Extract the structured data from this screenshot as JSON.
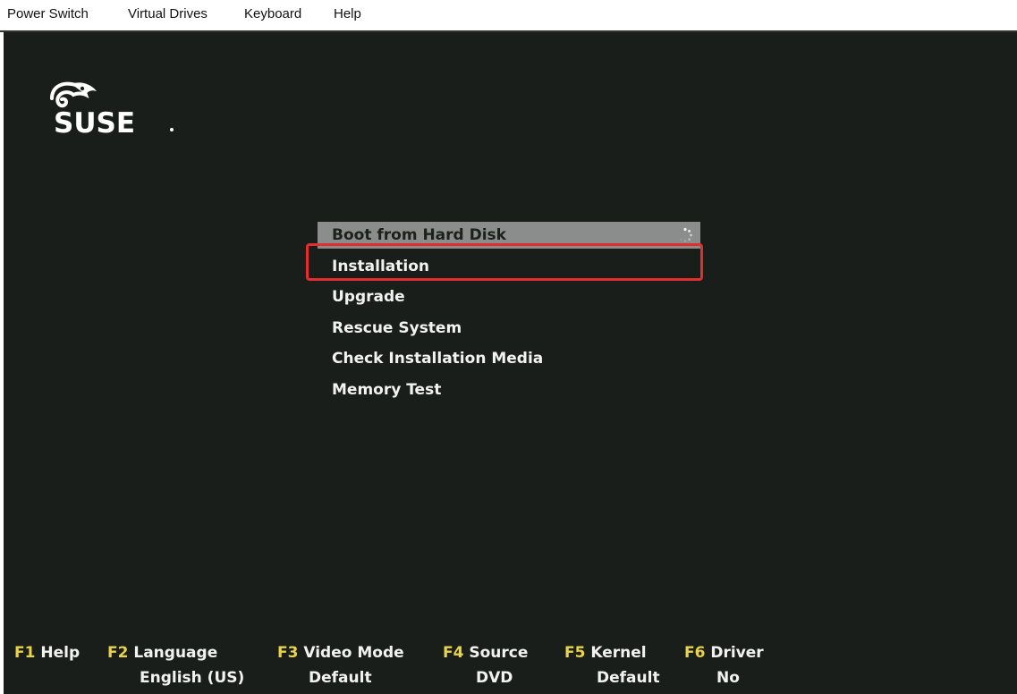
{
  "menubar": {
    "items": [
      "Power Switch",
      "Virtual Drives",
      "Keyboard",
      "Help"
    ]
  },
  "logo": {
    "text": "SUSE",
    "icon": "chameleon-icon"
  },
  "boot_menu": {
    "items": [
      {
        "label": "Boot from Hard Disk",
        "selected": true
      },
      {
        "label": "Installation",
        "selected": false
      },
      {
        "label": "Upgrade",
        "selected": false
      },
      {
        "label": "Rescue System",
        "selected": false
      },
      {
        "label": "Check Installation Media",
        "selected": false
      },
      {
        "label": "Memory Test",
        "selected": false
      }
    ],
    "spinner_icon": "loading-spinner-icon"
  },
  "annotation": {
    "highlight_color": "#e22e2e",
    "highlighted_item": "Installation"
  },
  "function_keys": [
    {
      "key": "F1",
      "label": "Help",
      "value": ""
    },
    {
      "key": "F2",
      "label": "Language",
      "value": "English (US)"
    },
    {
      "key": "F3",
      "label": "Video Mode",
      "value": "Default"
    },
    {
      "key": "F4",
      "label": "Source",
      "value": "DVD"
    },
    {
      "key": "F5",
      "label": "Kernel",
      "value": "Default"
    },
    {
      "key": "F6",
      "label": "Driver",
      "value": "No"
    }
  ],
  "colors": {
    "console_bg": "#1a1e1b",
    "selected_bg": "#8a8d8b",
    "fkey_accent": "#e8d34a",
    "text": "#f2f2f2"
  }
}
